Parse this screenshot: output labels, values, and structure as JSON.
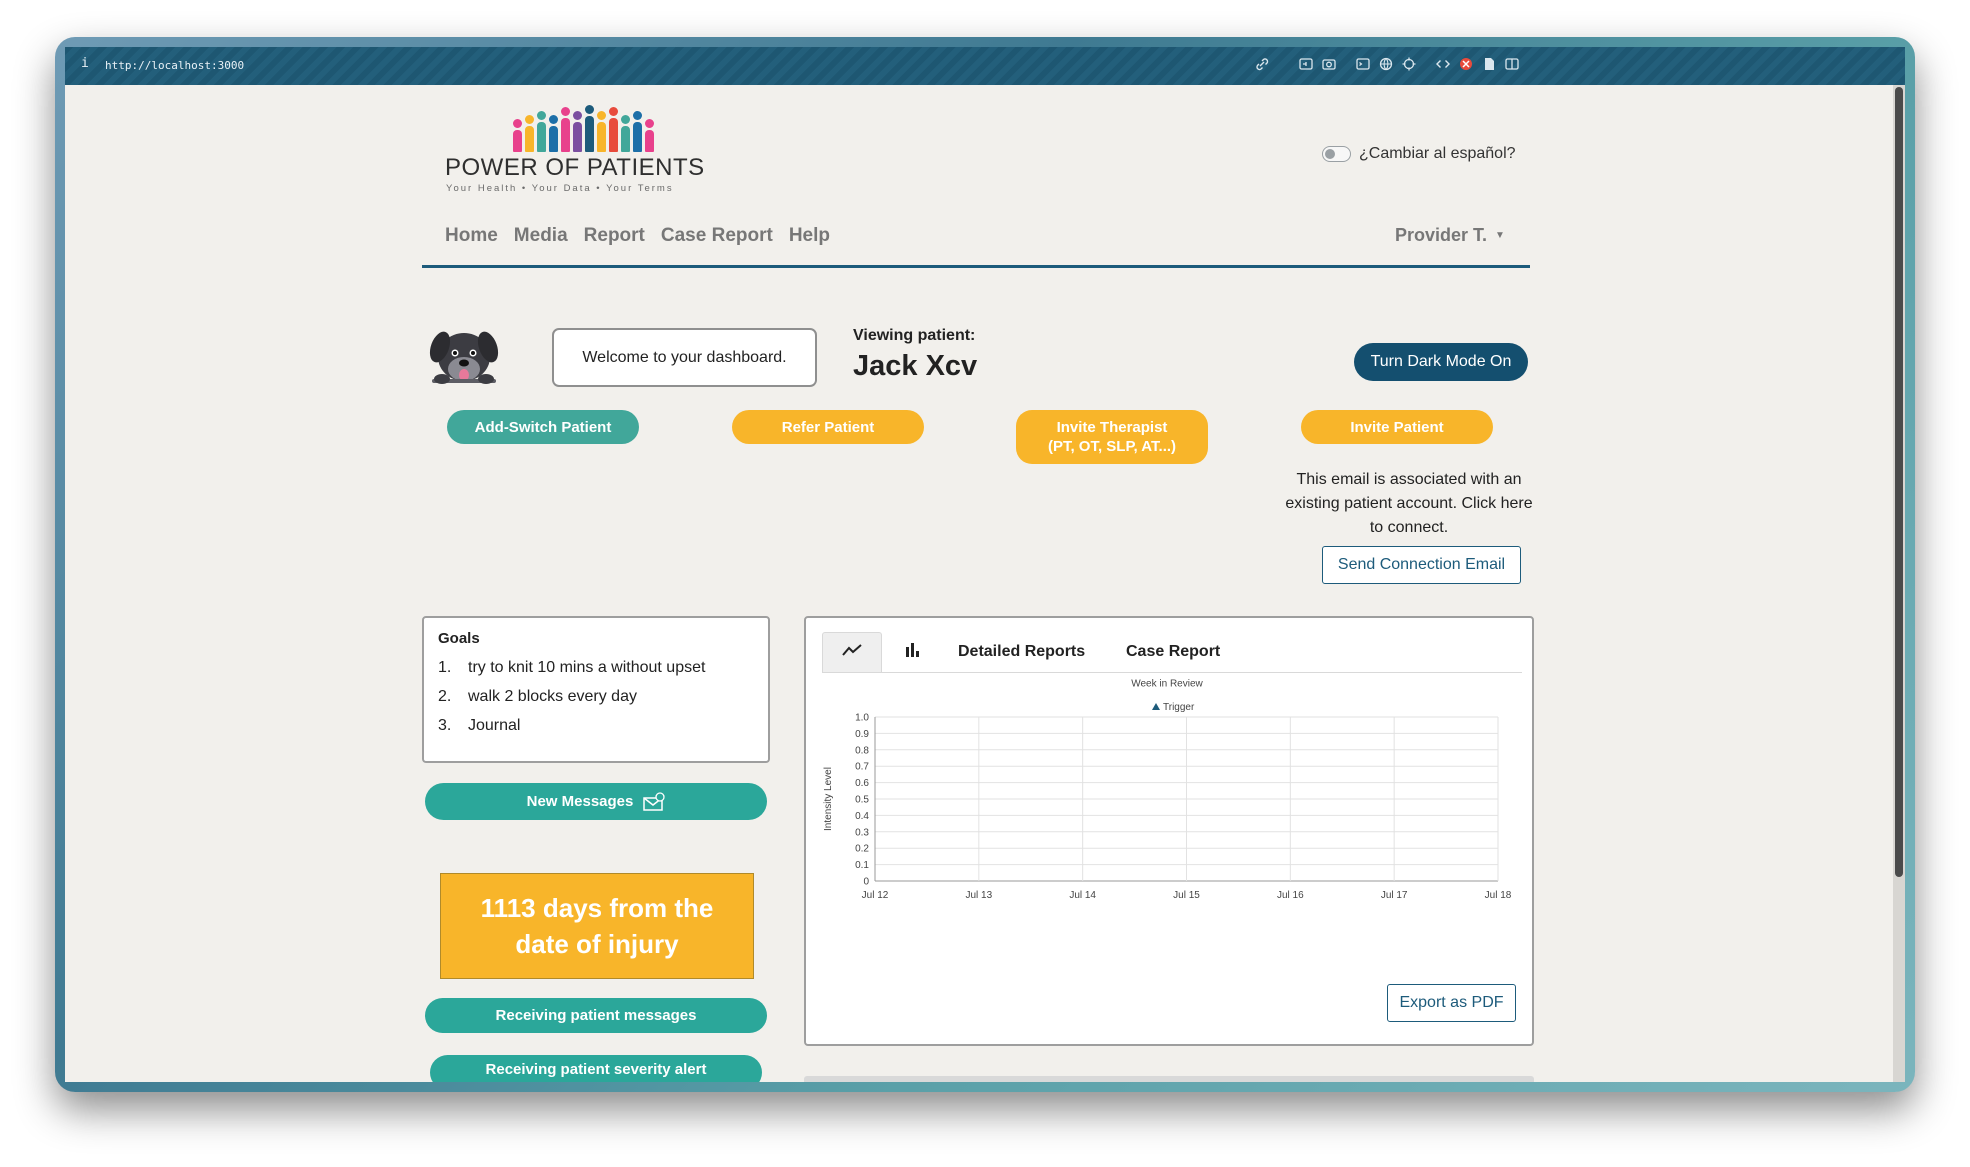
{
  "browser": {
    "info_glyph": "i",
    "url": "http://localhost:3000"
  },
  "logo": {
    "name": "POWER OF PATIENTS",
    "tagline": "Your Health • Your Data • Your Terms",
    "people_colors": [
      "#e8418c",
      "#f8b52a",
      "#41a79a",
      "#1d6fa8",
      "#e8418c",
      "#7b4fa0",
      "#1d5b7b",
      "#f8b52a",
      "#e84b3c",
      "#41a79a",
      "#1d6fa8",
      "#e8418c"
    ]
  },
  "language_toggle": {
    "label": "¿Cambiar al español?"
  },
  "nav": {
    "items": [
      "Home",
      "Media",
      "Report",
      "Case Report",
      "Help"
    ],
    "provider": "Provider T."
  },
  "dashboard": {
    "welcome": "Welcome to your dashboard.",
    "viewing_label": "Viewing patient:",
    "patient_name": "Jack Xcv",
    "dark_mode_button": "Turn Dark Mode On"
  },
  "actions": {
    "add_switch": "Add-Switch Patient",
    "refer": "Refer Patient",
    "invite_therapist_line1": "Invite Therapist",
    "invite_therapist_line2": "(PT, OT, SLP, AT...)",
    "invite_patient": "Invite Patient"
  },
  "association": {
    "message": "This email is associated with an existing patient account. Click here to connect.",
    "button": "Send Connection Email"
  },
  "goals": {
    "title": "Goals",
    "items": [
      {
        "num": "1.",
        "text": "try to knit 10 mins a without upset"
      },
      {
        "num": "2.",
        "text": "walk 2 blocks every day"
      },
      {
        "num": "3.",
        "text": "Journal"
      }
    ]
  },
  "sidebar": {
    "new_messages": "New Messages",
    "days_from_injury": "1113 days from the date of injury",
    "receiving_messages": "Receiving patient messages",
    "receiving_severity": "Receiving patient severity alert"
  },
  "chart_tabs": {
    "detailed": "Detailed Reports",
    "case": "Case Report"
  },
  "export_button": "Export as PDF",
  "colors": {
    "navy": "#1d5b7b",
    "teal": "#41a79a",
    "orange": "#f8b52a",
    "series": "#1d5b7b"
  },
  "chart_data": {
    "type": "line",
    "title": "Week in Review",
    "xlabel": "",
    "ylabel": "Intensity Level",
    "categories": [
      "Jul 12",
      "Jul 13",
      "Jul 14",
      "Jul 15",
      "Jul 16",
      "Jul 17",
      "Jul 18"
    ],
    "y_ticks": [
      "0",
      "0.1",
      "0.2",
      "0.3",
      "0.4",
      "0.5",
      "0.6",
      "0.7",
      "0.8",
      "0.9",
      "1.0"
    ],
    "ylim": [
      0,
      1.0
    ],
    "grid": true,
    "legend_position": "top-center",
    "series": [
      {
        "name": "Trigger",
        "values": []
      }
    ]
  }
}
